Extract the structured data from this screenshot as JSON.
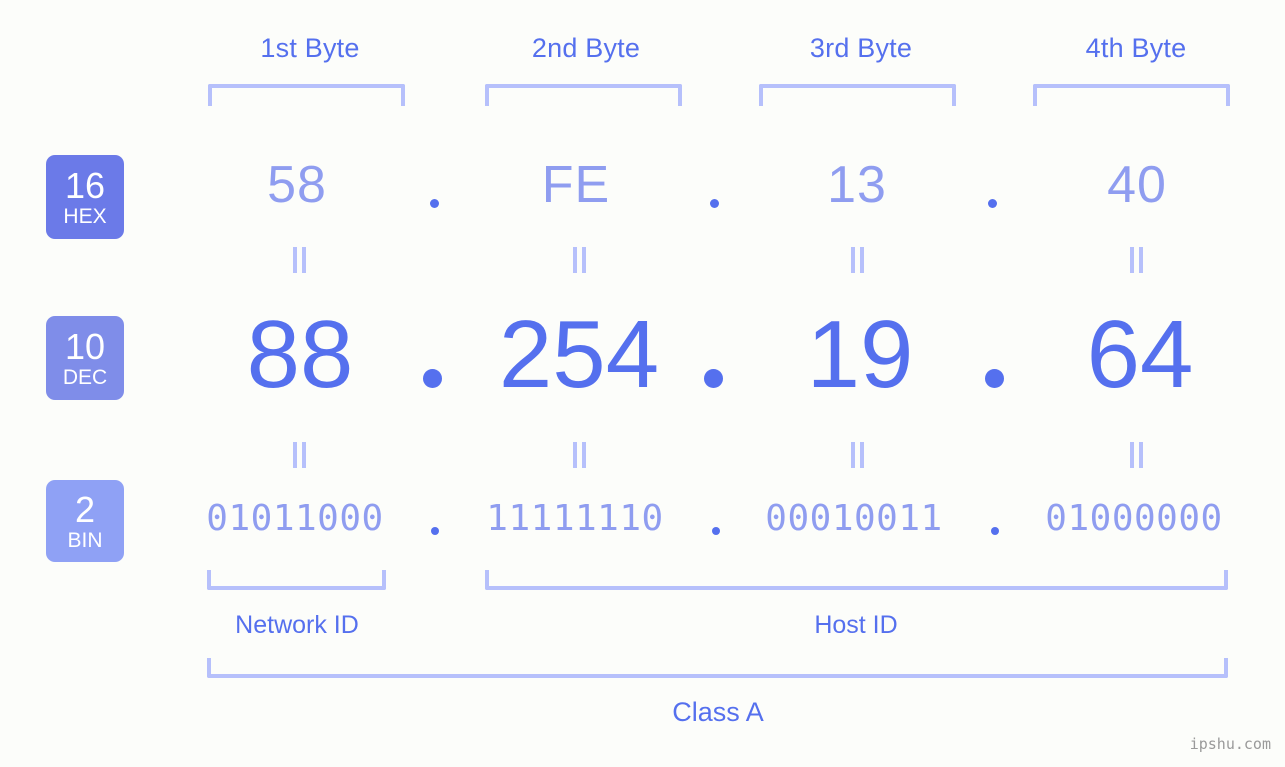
{
  "ip": {
    "hex": "58.FE.13.40",
    "dec": "88.254.19.64",
    "bin": "01011000.11111110.00010011.01000000"
  },
  "byte_headers": [
    {
      "label": "1st Byte"
    },
    {
      "label": "2nd Byte"
    },
    {
      "label": "3rd Byte"
    },
    {
      "label": "4th Byte"
    }
  ],
  "radix_badges": [
    {
      "base": "16",
      "name": "HEX",
      "color": "#6b7ae8"
    },
    {
      "base": "10",
      "name": "DEC",
      "color": "#7f8de9"
    },
    {
      "base": "2",
      "name": "BIN",
      "color": "#8fa1f5"
    }
  ],
  "rows": {
    "hex": {
      "values": [
        "58",
        "FE",
        "13",
        "40"
      ],
      "separator": "."
    },
    "dec": {
      "values": [
        "88",
        "254",
        "19",
        "64"
      ],
      "separator": "."
    },
    "bin": {
      "values": [
        "01011000",
        "11111110",
        "00010011",
        "01000000"
      ],
      "separator": "."
    }
  },
  "sections": [
    {
      "label": "Network ID"
    },
    {
      "label": "Host ID"
    }
  ],
  "class": {
    "label": "Class A"
  },
  "watermark": {
    "text": "ipshu.com"
  },
  "colors": {
    "background": "#fcfdfa",
    "accent": "#5570ee",
    "accent_light": "#8f9df0",
    "bracket": "#b6c0fb",
    "watermark": "#9a9a9a"
  }
}
